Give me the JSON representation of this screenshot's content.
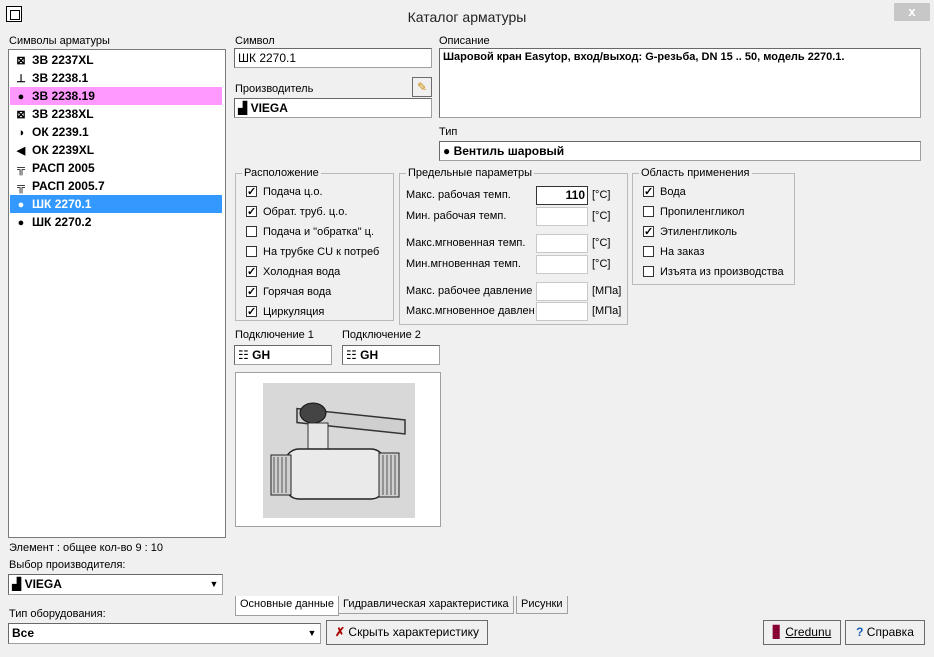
{
  "window": {
    "title": "Каталог арматуры",
    "close_label": "x"
  },
  "symbols": {
    "label": "Символы арматуры",
    "items": [
      {
        "icon": "⊠",
        "label": "ЗВ 2237XL",
        "state": ""
      },
      {
        "icon": "⊥",
        "label": "ЗВ 2238.1",
        "state": ""
      },
      {
        "icon": "●",
        "label": "ЗВ 2238.19",
        "state": "pink"
      },
      {
        "icon": "⊠",
        "label": "ЗВ 2238XL",
        "state": ""
      },
      {
        "icon": "◑",
        "label": "ОК 2239.1",
        "state": ""
      },
      {
        "icon": "◀",
        "label": "ОК 2239XL",
        "state": ""
      },
      {
        "icon": "╦",
        "label": "РАСП 2005",
        "state": ""
      },
      {
        "icon": "╦",
        "label": "РАСП 2005.7",
        "state": ""
      },
      {
        "icon": "●",
        "label": "ШК 2270.1",
        "state": "blue"
      },
      {
        "icon": "●",
        "label": "ШК 2270.2",
        "state": ""
      }
    ],
    "count_text": "Элемент : общее кол-во 9 : 10"
  },
  "symbol": {
    "label": "Символ",
    "value": "ШК 2270.1"
  },
  "producer": {
    "label": "Производитель",
    "value": "VIEGA"
  },
  "description": {
    "label": "Описание",
    "value": "Шаровой кран Easytop, вход/выход: G-резьба, DN 15 .. 50, модель 2270.1."
  },
  "type": {
    "label": "Тип",
    "value": "Вентиль шаровый"
  },
  "location": {
    "title": "Расположение",
    "items": [
      {
        "label": "Подача ц.о.",
        "checked": true
      },
      {
        "label": "Обрат. труб. ц.о.",
        "checked": true
      },
      {
        "label": "Подача и \"обратка\" ц.",
        "checked": false
      },
      {
        "label": "На трубке CU к потреб",
        "checked": false
      },
      {
        "label": "Холодная вода",
        "checked": true
      },
      {
        "label": "Горячая вода",
        "checked": true
      },
      {
        "label": "Циркуляция",
        "checked": true
      }
    ]
  },
  "limits": {
    "title": "Предельные параметры",
    "rows": [
      {
        "label": "Макс. рабочая темп.",
        "value": "110",
        "unit": "[°C]"
      },
      {
        "label": "Мин. рабочая темп.",
        "value": "",
        "unit": "[°C]"
      },
      {
        "label": "Макс.мгновенная темп.",
        "value": "",
        "unit": "[°C]"
      },
      {
        "label": "Мин.мгновенная темп.",
        "value": "",
        "unit": "[°C]"
      },
      {
        "label": "Макс. рабочее давление",
        "value": "",
        "unit": "[МПа]"
      },
      {
        "label": "Макс.мгновенное давлен",
        "value": "",
        "unit": "[МПа]"
      }
    ]
  },
  "application": {
    "title": "Область применения",
    "items": [
      {
        "label": "Вода",
        "checked": true
      },
      {
        "label": "Пропиленгликол",
        "checked": false
      },
      {
        "label": "Этиленгликоль",
        "checked": true
      },
      {
        "label": "На заказ",
        "checked": false
      },
      {
        "label": "Изъята из производства",
        "checked": false
      }
    ]
  },
  "connection1": {
    "label": "Подключение 1",
    "value": "GH"
  },
  "connection2": {
    "label": "Подключение 2",
    "value": "GH"
  },
  "producer_select": {
    "label": "Выбор производителя:",
    "value": "VIEGA"
  },
  "equipment_type": {
    "label": "Тип оборудования:",
    "value": "Все"
  },
  "buttons": {
    "hide": "Скрыть характеристику",
    "tools": "Credunu",
    "help": "Справка"
  },
  "tabs": [
    "Основные данные",
    "Гидравлическая характеристика",
    "Рисунки"
  ]
}
